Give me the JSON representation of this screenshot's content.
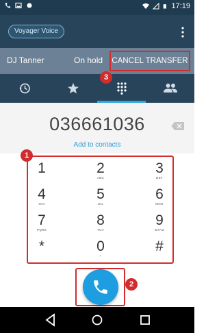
{
  "status_bar": {
    "time": "17:19"
  },
  "app_bar": {
    "account_label": "Voyager Voice"
  },
  "hold_bar": {
    "caller_name": "DJ Tanner",
    "status": "On hold",
    "cancel_transfer_label": "CANCEL TRANSFER"
  },
  "tabs": [
    {
      "icon": "history-icon",
      "active": false
    },
    {
      "icon": "star-icon",
      "active": false
    },
    {
      "icon": "dialpad-icon",
      "active": true
    },
    {
      "icon": "contacts-icon",
      "active": false
    }
  ],
  "dialer": {
    "number": "036661036",
    "add_contact_label": "Add to contacts"
  },
  "keypad": {
    "keys": [
      {
        "digit": "1",
        "letters": ""
      },
      {
        "digit": "2",
        "letters": "ABC"
      },
      {
        "digit": "3",
        "letters": "DEF"
      },
      {
        "digit": "4",
        "letters": "GHI"
      },
      {
        "digit": "5",
        "letters": "JKL"
      },
      {
        "digit": "6",
        "letters": "MNO"
      },
      {
        "digit": "7",
        "letters": "PQRS"
      },
      {
        "digit": "8",
        "letters": "TUV"
      },
      {
        "digit": "9",
        "letters": "WXYZ"
      },
      {
        "digit": "*",
        "letters": ""
      },
      {
        "digit": "0",
        "letters": "+"
      },
      {
        "digit": "#",
        "letters": ""
      }
    ]
  },
  "annotations": {
    "badge_1": "1",
    "badge_2": "2",
    "badge_3": "3"
  },
  "colors": {
    "accent": "#1e9de0",
    "highlight": "#d32c2c",
    "appbar": "#28445a"
  }
}
